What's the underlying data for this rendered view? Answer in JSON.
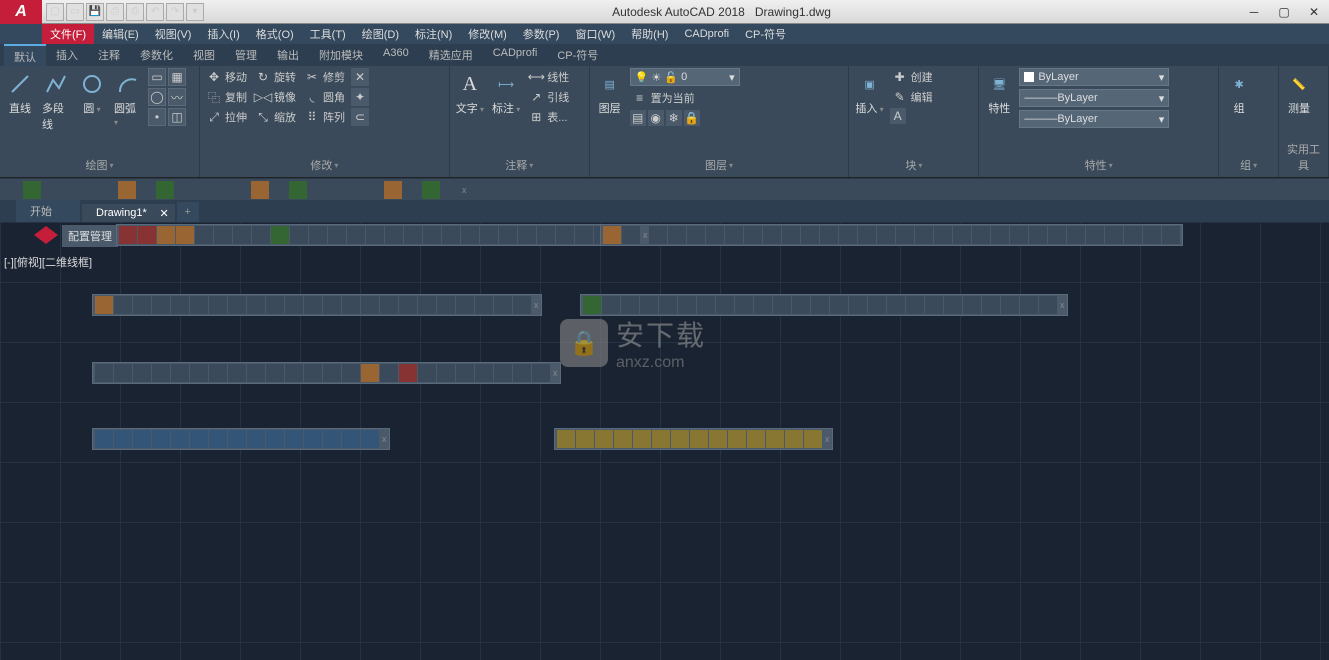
{
  "title": {
    "app": "Autodesk AutoCAD 2018",
    "doc": "Drawing1.dwg"
  },
  "qat_icons": [
    "new-icon",
    "open-icon",
    "save-icon",
    "saveas-icon",
    "print-icon",
    "undo-icon",
    "redo-icon"
  ],
  "menus": [
    "文件(F)",
    "编辑(E)",
    "视图(V)",
    "插入(I)",
    "格式(O)",
    "工具(T)",
    "绘图(D)",
    "标注(N)",
    "修改(M)",
    "参数(P)",
    "窗口(W)",
    "帮助(H)",
    "CADprofi",
    "CP-符号"
  ],
  "menu_active_index": 0,
  "ribbon_tabs": [
    "默认",
    "插入",
    "注释",
    "参数化",
    "视图",
    "管理",
    "输出",
    "附加模块",
    "A360",
    "精选应用",
    "CADprofi",
    "CP-符号"
  ],
  "ribbon_active_index": 0,
  "panels": {
    "draw": {
      "title": "绘图",
      "tools_big": [
        {
          "name": "line-tool",
          "label": "直线"
        },
        {
          "name": "polyline-tool",
          "label": "多段线"
        },
        {
          "name": "circle-tool",
          "label": "圆"
        },
        {
          "name": "arc-tool",
          "label": "圆弧"
        }
      ]
    },
    "modify": {
      "title": "修改",
      "rows": [
        {
          "name": "move-tool",
          "icon": "↔",
          "label": "移动"
        },
        {
          "name": "copy-tool",
          "icon": "⿻",
          "label": "复制"
        },
        {
          "name": "stretch-tool",
          "icon": "⤢",
          "label": "拉伸"
        },
        {
          "name": "rotate-tool",
          "icon": "↻",
          "label": "旋转"
        },
        {
          "name": "mirror-tool",
          "icon": "▷◁",
          "label": "镜像"
        },
        {
          "name": "scale-tool",
          "icon": "⤡",
          "label": "缩放"
        },
        {
          "name": "trim-tool",
          "icon": "✂",
          "label": "修剪"
        },
        {
          "name": "fillet-tool",
          "icon": "◟",
          "label": "圆角"
        },
        {
          "name": "array-tool",
          "icon": "⠿",
          "label": "阵列"
        }
      ]
    },
    "annotate": {
      "title": "注释",
      "text_label": "文字",
      "dim_label": "标注",
      "table_label": "表...",
      "sub": [
        {
          "name": "linear-dim-tool",
          "label": "线性"
        },
        {
          "name": "leader-tool",
          "label": "引线"
        }
      ]
    },
    "layer": {
      "title": "图层",
      "btn": "图层",
      "current": "置为当前",
      "value": "0"
    },
    "block": {
      "title": "块",
      "insert": "插入",
      "create": "创建",
      "edit": "编辑"
    },
    "props": {
      "title": "特性",
      "btn": "特性",
      "bylayer": "ByLayer"
    },
    "group": {
      "title": "组",
      "btn": "组"
    },
    "util": {
      "title": "实用工具",
      "btn": "测量"
    }
  },
  "doctabs": [
    {
      "label": "开始",
      "active": false
    },
    {
      "label": "Drawing1*",
      "active": true
    }
  ],
  "config_label": "配置管理",
  "view_label": "[-][俯视][二维线框]",
  "watermark": {
    "main": "安下载",
    "sub": "anxz.com"
  },
  "toolbar_counts": {
    "strip1": 26,
    "strip2": 2,
    "strip3a": 23,
    "strip3b": 25,
    "strip4": 24,
    "strip5a": 15,
    "strip5b": 14
  }
}
